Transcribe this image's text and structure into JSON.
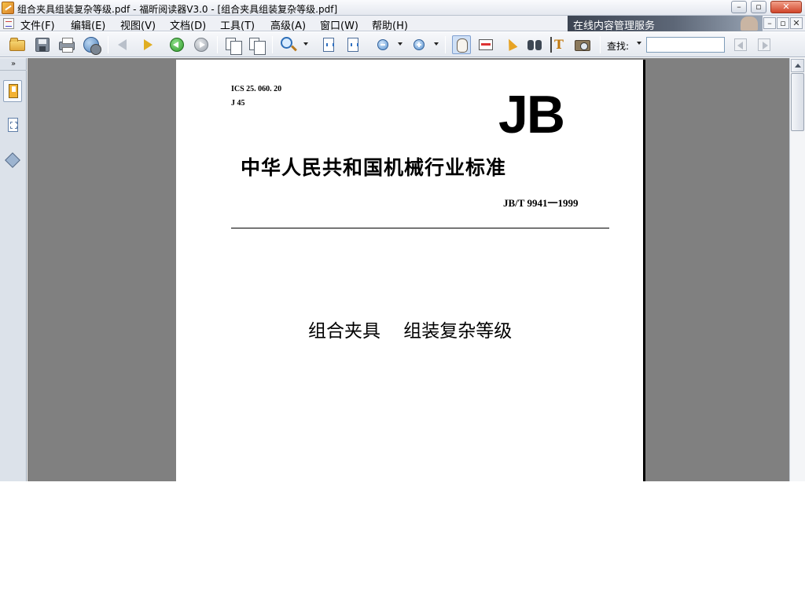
{
  "window": {
    "title": "组合夹具组装复杂等级.pdf - 福昕阅读器V3.0 - [组合夹具组装复杂等级.pdf]",
    "minimize": "–",
    "maximize": "▫",
    "close": "✕"
  },
  "menu": {
    "items": [
      {
        "label": "文件(F)"
      },
      {
        "label": "编辑(E)"
      },
      {
        "label": "视图(V)"
      },
      {
        "label": "文档(D)"
      },
      {
        "label": "工具(T)"
      },
      {
        "label": "高级(A)"
      },
      {
        "label": "窗口(W)"
      },
      {
        "label": "帮助(H)"
      }
    ],
    "promo": "在线内容管理服务",
    "mdi_minimize": "–",
    "mdi_restore": "▫",
    "mdi_close": "✕"
  },
  "toolbar": {
    "find_label": "查找:",
    "find_value": "",
    "icons": [
      "open-icon",
      "save-icon",
      "print-icon",
      "web-icon",
      "prev-page-icon",
      "next-page-icon",
      "back-icon",
      "forward-icon",
      "rotate-icon",
      "zoom-in-icon",
      "fit-page-icon",
      "fit-width-icon",
      "zoom-out-icon",
      "zoom-plus-icon",
      "hand-icon",
      "select-text-icon",
      "pointer-icon",
      "find-icon",
      "typewriter-icon",
      "snapshot-icon",
      "find-prev-icon",
      "find-next-icon"
    ]
  },
  "sidebar": {
    "collapse": "»",
    "tabs": [
      "bookmarks-icon",
      "pages-icon",
      "layers-icon"
    ]
  },
  "document": {
    "ics": "ICS 25. 060. 20",
    "jcode": "J 45",
    "logo": "JB",
    "standard_title": "中华人民共和国机械行业标准",
    "standard_number": "JB/T  9941一1999",
    "subject": "组合夹具    组装复杂等级"
  }
}
